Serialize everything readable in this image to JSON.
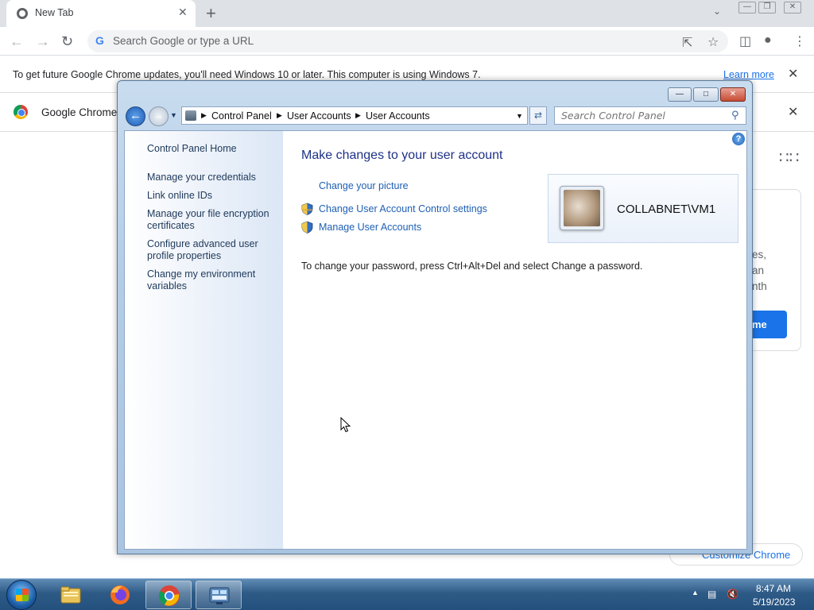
{
  "browser": {
    "tab_title": "New Tab",
    "tab_close": "✕",
    "new_tab": "+",
    "omnibox_placeholder": "Search Google or type a URL",
    "infobar_message": "To get future Google Chrome updates, you'll need Windows 10 or later. This computer is using Windows 7.",
    "infobar_link": "Learn more",
    "infobar_close": "✕",
    "default_bar_text": "Google Chrome",
    "default_bar_close": "✕",
    "ntp_card_lines": [
      "es,",
      "an",
      "nth"
    ],
    "ntp_card_button": "me",
    "customize_label": "Customize Chrome"
  },
  "control_panel": {
    "breadcrumbs": [
      "Control Panel",
      "User Accounts",
      "User Accounts"
    ],
    "search_placeholder": "Search Control Panel",
    "sidebar": {
      "home": "Control Panel Home",
      "links": [
        "Manage your credentials",
        "Link online IDs",
        "Manage your file encryption certificates",
        "Configure advanced user profile properties",
        "Change my environment variables"
      ]
    },
    "main_title": "Make changes to your user account",
    "tasks": [
      "Change your picture",
      "Change User Account Control settings",
      "Manage User Accounts"
    ],
    "password_note": "To change your password, press Ctrl+Alt+Del and select Change a password.",
    "user_name": "COLLABNET\\VM1",
    "help_label": "?"
  },
  "taskbar": {
    "apps": [
      "windows-explorer",
      "firefox",
      "chrome",
      "control-panel"
    ],
    "clock_time": "8:47 AM",
    "clock_date": "5/19/2023"
  },
  "colors": {
    "chrome_blue": "#1a73e8",
    "cp_link": "#1e5fb4",
    "cp_title": "#1e3287",
    "taskbar": "#2e5a86"
  }
}
